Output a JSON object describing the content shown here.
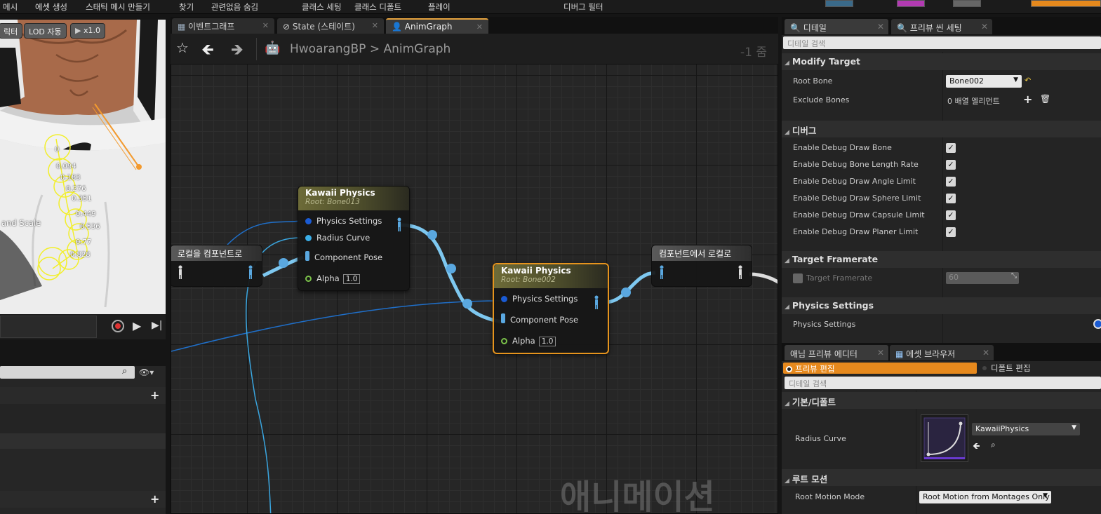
{
  "menubar": {
    "items": [
      "메시",
      "에셋 생성",
      "스태틱 메시 만들기",
      "찾기",
      "관련없음 숨김",
      "클래스 세팅",
      "클래스 디폴트",
      "플레이",
      "디버그 필터"
    ]
  },
  "viewport": {
    "filter_label": "릭터",
    "lod_label": "LOD 자동",
    "speed_label": "x1.0",
    "scale_label": "and Scale",
    "bone_values": [
      "0",
      "0.094",
      "0.183",
      "0.276",
      "0.351",
      "0.449",
      "0.536",
      "0.77",
      "0.828"
    ]
  },
  "graph": {
    "tabs": [
      {
        "label": "이벤트그래프",
        "icon": "event-graph-icon"
      },
      {
        "label": "State (스테이트)",
        "icon": "state-icon"
      },
      {
        "label": "AnimGraph",
        "icon": "anim-graph-icon"
      }
    ],
    "breadcrumb": {
      "blueprint": "HwoarangBP",
      "separator": ">",
      "graph": "AnimGraph"
    },
    "zoom": "-1 줌",
    "watermark": "애니메이션",
    "nodes": {
      "local_to_component": {
        "title": "로컬을 컴포넌트로"
      },
      "kawaii1": {
        "title": "Kawaii Physics",
        "subtitle": "Root: Bone013",
        "pins": [
          "Physics Settings",
          "Radius Curve",
          "Component Pose",
          "Alpha"
        ],
        "alpha": "1.0"
      },
      "kawaii2": {
        "title": "Kawaii Physics",
        "subtitle": "Root: Bone002",
        "pins": [
          "Physics Settings",
          "Component Pose",
          "Alpha"
        ],
        "alpha": "1.0"
      },
      "component_to_local": {
        "title": "컴포넌트에서 로컬로"
      }
    }
  },
  "details": {
    "tabs": [
      {
        "label": "디테일",
        "icon": "details-icon"
      },
      {
        "label": "프리뷰 씬 세팅",
        "icon": "preview-scene-icon"
      }
    ],
    "search_placeholder": "디테일 검색",
    "modify_target": {
      "header": "Modify Target",
      "root_bone_label": "Root Bone",
      "root_bone_value": "Bone002",
      "exclude_bones_label": "Exclude Bones",
      "exclude_bones_value": "0 배열 엘리먼트"
    },
    "debug": {
      "header": "디버그",
      "rows": [
        {
          "label": "Enable Debug Draw Bone",
          "checked": true
        },
        {
          "label": "Enable Debug Bone Length Rate",
          "checked": true
        },
        {
          "label": "Enable Debug Draw Angle Limit",
          "checked": true
        },
        {
          "label": "Enable Debug Draw Sphere Limit",
          "checked": true
        },
        {
          "label": "Enable Debug Draw Capsule Limit",
          "checked": true
        },
        {
          "label": "Enable Debug Draw Planer Limit",
          "checked": true
        }
      ]
    },
    "target_framerate": {
      "header": "Target Framerate",
      "label": "Target Framerate",
      "value": "60",
      "checked": false
    },
    "physics_settings": {
      "header": "Physics Settings",
      "label": "Physics Settings"
    }
  },
  "lower_right": {
    "tabs": [
      {
        "label": "애님 프리뷰 에디터"
      },
      {
        "label": "에셋 브라우저",
        "icon": "asset-browser-icon"
      }
    ],
    "preview_edit": "프리뷰 편집",
    "default_edit": "디폴트 편집",
    "search_placeholder": "디테일 검색",
    "basic_header": "기본/디폴트",
    "radius_curve_label": "Radius Curve",
    "radius_curve_asset": "KawaiiPhysics",
    "root_motion_header": "루트 모션",
    "root_motion_label": "Root Motion Mode",
    "root_motion_value": "Root Motion from Montages Only"
  },
  "colors": {
    "accent": "#e6a33e",
    "selected_node_border": "#e6941d",
    "pose_wire": "#7ec8f0",
    "exec_wire": "#1f6fc9"
  }
}
